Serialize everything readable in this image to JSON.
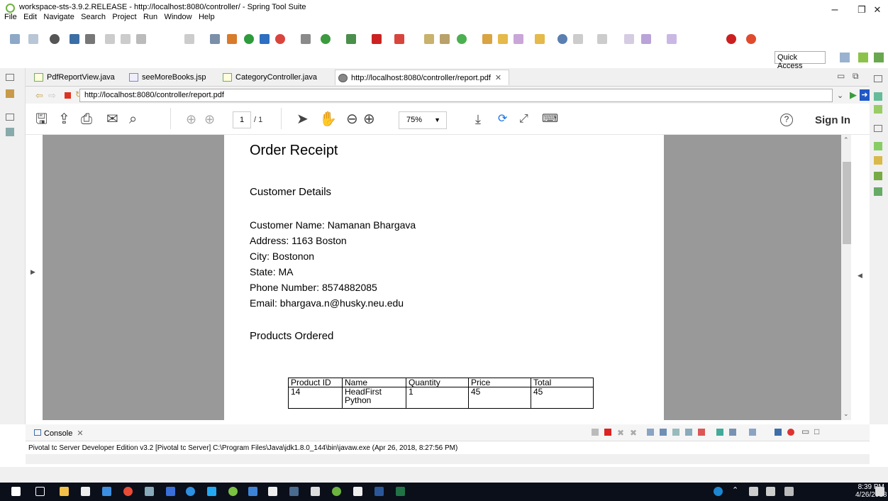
{
  "window": {
    "title": "workspace-sts-3.9.2.RELEASE - http://localhost:8080/controller/ - Spring Tool Suite",
    "minimize": "–",
    "maximize": "❐",
    "close": "✕"
  },
  "menu": [
    "File",
    "Edit",
    "Navigate",
    "Search",
    "Project",
    "Run",
    "Window",
    "Help"
  ],
  "quick_access": "Quick Access",
  "tabs": [
    {
      "label": "PdfReportView.java"
    },
    {
      "label": "seeMoreBooks.jsp"
    },
    {
      "label": "CategoryController.java"
    },
    {
      "label": "http://localhost:8080/controller/report.pdf",
      "close": "✕"
    }
  ],
  "url": "http://localhost:8080/controller/report.pdf",
  "pdf_toolbar": {
    "page_current": "1",
    "page_total": "/ 1",
    "zoom": "75%",
    "sign_in": "Sign In",
    "help": "?"
  },
  "document": {
    "title": "Order Receipt",
    "customer_heading": "Customer Details",
    "customer_lines": [
      "Customer Name: Namanan Bhargava",
      "Address: 1163 Boston",
      "City: Bostonon",
      "State: MA",
      "Phone Number: 8574882085",
      "Email: bhargava.n@husky.neu.edu"
    ],
    "products_heading": "Products Ordered",
    "table": {
      "headers": [
        "Product ID",
        "Name",
        "Quantity",
        "Price",
        "Total"
      ],
      "rows": [
        [
          "14",
          "HeadFirst Python",
          "1",
          "45",
          "45"
        ]
      ]
    }
  },
  "console": {
    "title": "Console",
    "line": "Pivotal tc Server Developer Edition v3.2 [Pivotal tc Server] C:\\Program Files\\Java\\jdk1.8.0_144\\bin\\javaw.exe (Apr 26, 2018, 8:27:56 PM)"
  },
  "taskbar": {
    "time": "8:39 PM",
    "date": "4/26/2018"
  },
  "colors": {
    "viewer_gray": "#999999",
    "taskbar_bg": "#0a0f1a",
    "accent_blue": "#1a73e8"
  }
}
